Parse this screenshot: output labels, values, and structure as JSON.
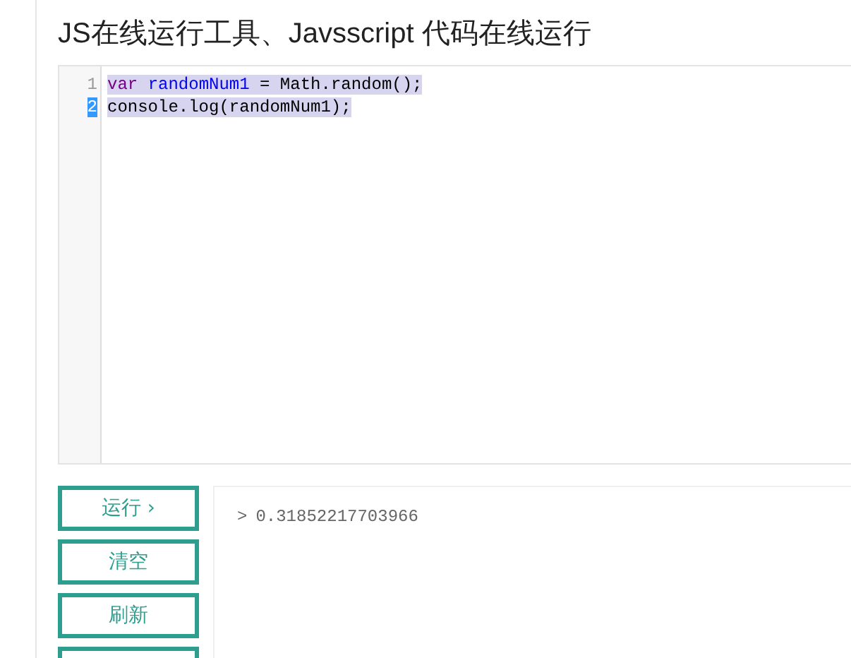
{
  "title": "JS在线运行工具、Javsscript 代码在线运行",
  "editor": {
    "lines": [
      {
        "number": "1",
        "active": false,
        "selected": true,
        "tokens": [
          {
            "kind": "keyword",
            "text": "var "
          },
          {
            "kind": "variable",
            "text": "randomNum1"
          },
          {
            "kind": "plain",
            "text": " = Math.random();"
          }
        ]
      },
      {
        "number": "2",
        "active": true,
        "selected": true,
        "tokens": [
          {
            "kind": "plain",
            "text": "console.log(randomNum1);"
          }
        ]
      }
    ]
  },
  "buttons": [
    {
      "label": "运行 ›"
    },
    {
      "label": "清空"
    },
    {
      "label": "刷新"
    }
  ],
  "cut_button_below": true,
  "output": {
    "prompt": ">",
    "value": "0.31852217703966"
  }
}
